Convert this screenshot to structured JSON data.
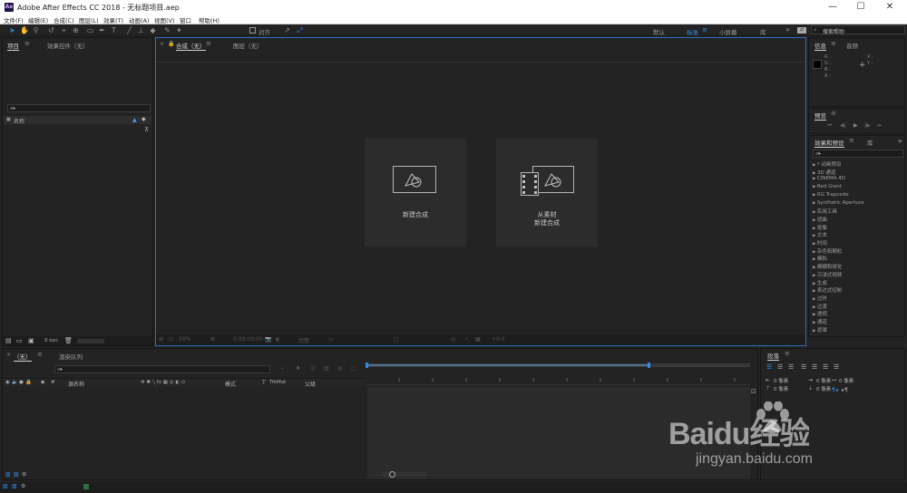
{
  "window": {
    "app_icon": "Ae",
    "title": "Adobe After Effects CC 2018 - 无标题项目.aep",
    "minimize": "—",
    "maximize": "☐",
    "close": "✕"
  },
  "menu": [
    "文件(F)",
    "编辑(E)",
    "合成(C)",
    "图层(L)",
    "效果(T)",
    "动画(A)",
    "视图(V)",
    "窗口",
    "帮助(H)"
  ],
  "toolbar": {
    "align_label": "对齐",
    "workspaces": [
      "默认",
      "标准",
      "小屏幕",
      "库"
    ],
    "active_workspace": "标准",
    "search_placeholder": "搜索帮助"
  },
  "project_panel": {
    "tabs": [
      "项目",
      "效果控件（无）"
    ],
    "search_icon": "⌕▸",
    "column_name": "名称",
    "bpc": "8 bpc"
  },
  "composition_panel": {
    "tabs": [
      "合成（无）",
      "图层（无）"
    ],
    "new_comp": "新建合成",
    "from_footage_line1": "从素材",
    "from_footage_line2": "新建合成",
    "zoom": "50%",
    "time": "0;00;00;00",
    "quality": "完整",
    "exposure": "+0.0"
  },
  "info_panel": {
    "tabs": [
      "信息",
      "音频"
    ],
    "r": "R :",
    "g": "G :",
    "b": "B :",
    "a": "A :",
    "x": "X :",
    "y": "Y :"
  },
  "preview_panel": {
    "tab": "预览",
    "controls": [
      "⏮",
      "◀|",
      "▶",
      "|▶",
      "⏭"
    ]
  },
  "effects_panel": {
    "tabs": [
      "效果和预设",
      "库"
    ],
    "search_icon": "⌕▸",
    "items": [
      "* 动画预设",
      "3D 通道",
      "CINEMA 4D",
      "Red Giant",
      "RG Trapcode",
      "Synthetic Aperture",
      "实用工具",
      "扭曲",
      "抠像",
      "文本",
      "时间",
      "杂色和颗粒",
      "模拟",
      "模糊和锐化",
      "沉浸式视频",
      "生成",
      "表达式控制",
      "过时",
      "过渡",
      "透视",
      "通道",
      "遮罩"
    ]
  },
  "timeline": {
    "tabs": [
      "（无）",
      "渲染队列"
    ],
    "search_icon": "⌕▸",
    "columns": [
      "源名称",
      "模式",
      "T",
      "TrkMat",
      "父级"
    ]
  },
  "paragraph_panel": {
    "tab": "段落",
    "fields": [
      "0 像素",
      "0 像素",
      "0 像素",
      "0 像素",
      "0 像素"
    ]
  },
  "watermark": {
    "brand": "Baidu经验",
    "url": "jingyan.baidu.com"
  }
}
